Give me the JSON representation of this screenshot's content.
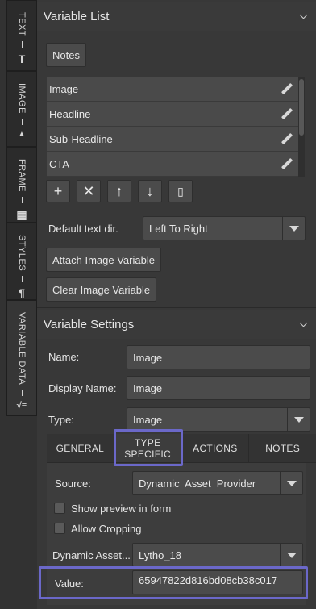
{
  "vertical_tabs": [
    {
      "label": "TEXT",
      "icon": "T"
    },
    {
      "label": "IMAGE",
      "icon": "▲"
    },
    {
      "label": "FRAME",
      "icon": "▦"
    },
    {
      "label": "STYLES",
      "icon": "¶"
    },
    {
      "label": "VARIABLE DATA",
      "icon": "√≡"
    }
  ],
  "variable_list": {
    "title": "Variable List",
    "notes_button": "Notes",
    "items": [
      "Image",
      "Headline",
      "Sub-Headline",
      "CTA"
    ],
    "default_text_dir_label": "Default text dir.",
    "default_text_dir_value": "Left To Right",
    "attach_button": "Attach Image Variable",
    "clear_button": "Clear Image Variable"
  },
  "variable_settings": {
    "title": "Variable Settings",
    "name_label": "Name:",
    "name_value": "Image",
    "display_name_label": "Display Name:",
    "display_name_value": "Image",
    "type_label": "Type:",
    "type_value": "Image",
    "tabs": [
      "GENERAL",
      "TYPE\nSPECIFIC",
      "ACTIONS",
      "NOTES"
    ],
    "source_label": "Source:",
    "source_value": "Dynamic  Asset  Provider",
    "show_preview_label": "Show preview in form",
    "allow_cropping_label": "Allow Cropping",
    "dynamic_asset_label": "Dynamic Asset...",
    "dynamic_asset_value": "Lytho_18",
    "value_label": "Value:",
    "value_value": "65947822d816bd08cb38c017"
  },
  "colors": {
    "highlight": "#6b68c9",
    "panel": "#383838",
    "field": "#4b4b4b"
  }
}
